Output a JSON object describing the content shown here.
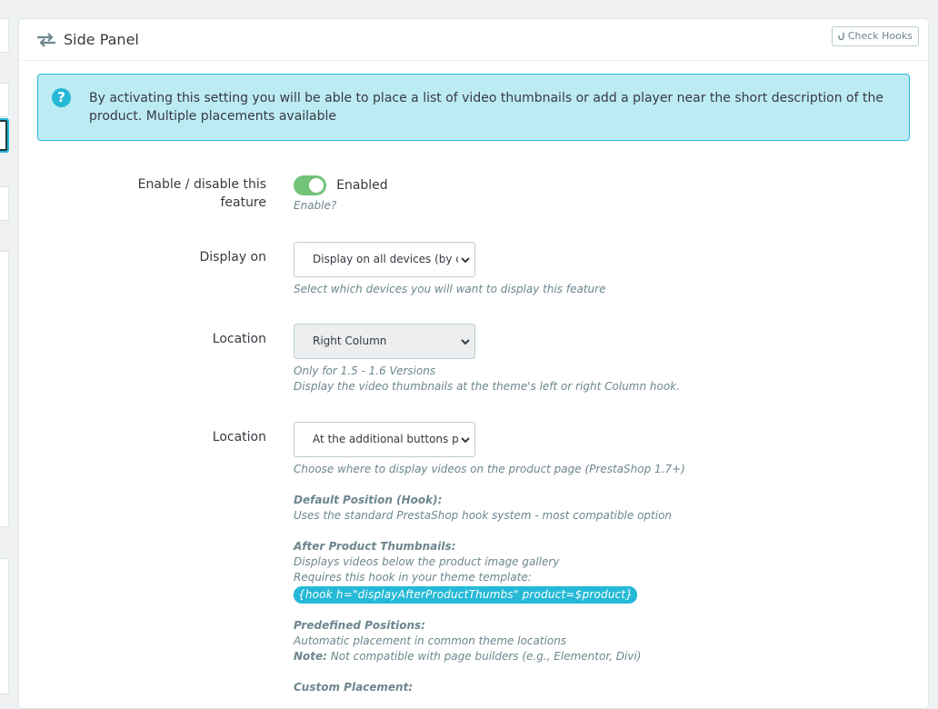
{
  "panel": {
    "title": "Side Panel",
    "check_hooks_label": "Check Hooks"
  },
  "alert": {
    "text": "By activating this setting you will be able to place a list of video thumbnails or add a player near the short description of the product. Multiple placements available"
  },
  "fields": {
    "enable": {
      "label_line1": "Enable / disable this",
      "label_line2": "feature",
      "state_label": "Enabled",
      "checked": true,
      "help": "Enable?"
    },
    "display_on": {
      "label": "Display on",
      "value": "Display on all devices (by default)",
      "help": "Select which devices you will want to display this feature"
    },
    "location_column": {
      "label": "Location",
      "value": "Right Column",
      "help_line1": "Only for 1.5 - 1.6 Versions",
      "help_line2": "Display the video thumbnails at the theme's left or right Column hook."
    },
    "location_product": {
      "label": "Location",
      "value": "At the additional buttons place",
      "help_intro": "Choose where to display videos on the product page (PrestaShop 1.7+)",
      "default_title": "Default Position (Hook):",
      "default_desc": "Uses the standard PrestaShop hook system - most compatible option",
      "thumbs_title": "After Product Thumbnails:",
      "thumbs_desc1": "Displays videos below the product image gallery",
      "thumbs_desc2": "Requires this hook in your theme template:",
      "thumbs_code": "{hook h=\"displayAfterProductThumbs\" product=$product}",
      "predefined_title": "Predefined Positions:",
      "predefined_desc": "Automatic placement in common theme locations",
      "note_label": "Note:",
      "note_text": " Not compatible with page builders (e.g., Elementor, Divi)",
      "custom_title": "Custom Placement:"
    }
  },
  "colors": {
    "accent": "#25b9d7",
    "switch_on": "#72c279",
    "alert_bg": "#bdebf4"
  }
}
